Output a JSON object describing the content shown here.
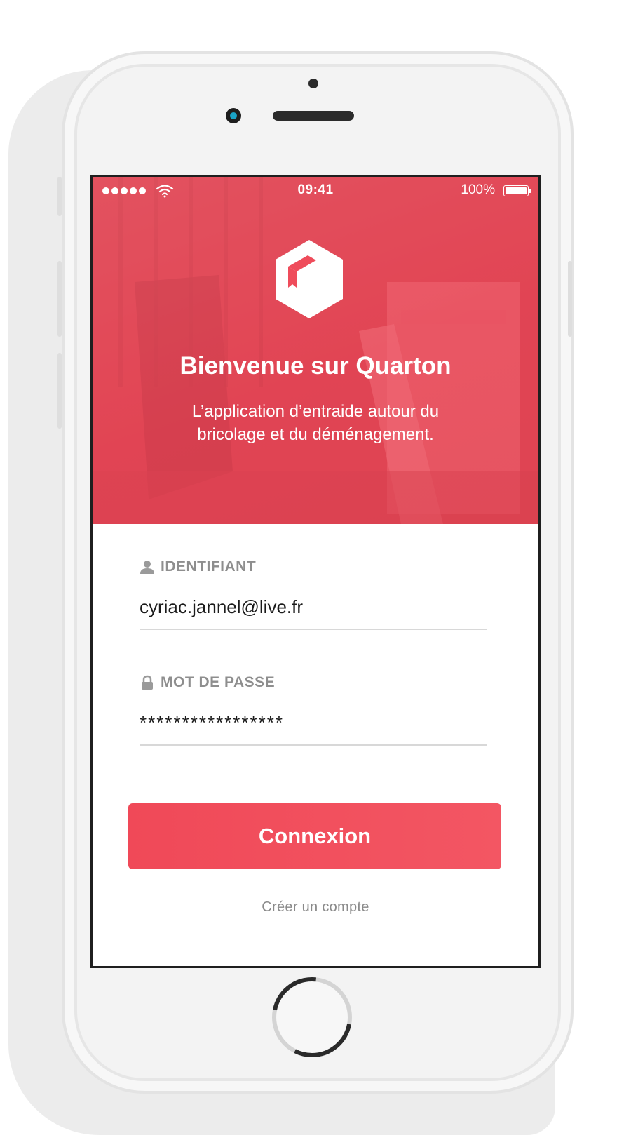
{
  "status_bar": {
    "time": "09:41",
    "battery_percent": "100%",
    "signal_icon": "signal-dots-icon",
    "wifi_icon": "wifi-icon",
    "battery_icon": "battery-icon"
  },
  "hero": {
    "logo_icon": "box-icon",
    "title": "Bienvenue sur Quarton",
    "subtitle_line1": "L’application d’entraide autour du",
    "subtitle_line2": "bricolage et du déménagement.",
    "accent_color": "#EF4C5B"
  },
  "form": {
    "identifier": {
      "icon": "user-icon",
      "label": "IDENTIFIANT",
      "value": "cyriac.jannel@live.fr"
    },
    "password": {
      "icon": "lock-icon",
      "label": "MOT DE PASSE",
      "value": "*****************"
    },
    "login_button": "Connexion",
    "create_account_link": "Créer un compte"
  }
}
